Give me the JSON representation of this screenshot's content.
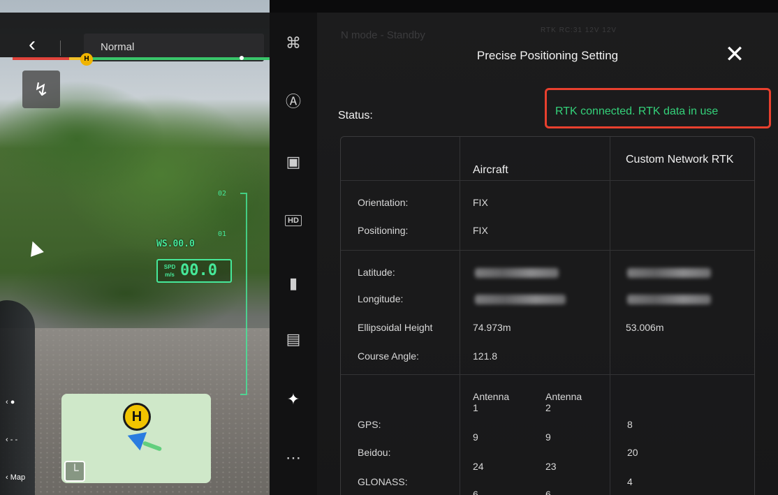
{
  "camera": {
    "mode": "Normal",
    "home_marker": "H",
    "ws_label": "WS.00.0",
    "speed_unit_top": "SPD",
    "speed_unit_bottom": "m/s",
    "speed_value": "00.0",
    "hud_mark_top": "02",
    "hud_mark_mid": "01",
    "map_label": "Map",
    "minimap_home": "H",
    "icons": [
      "back-icon",
      "route-icon",
      "aircraft-arrow-icon",
      "map-toggle-icon"
    ]
  },
  "iconcol": {
    "icons": [
      "aircraft-icon",
      "obstacle-icon",
      "remote-controller-icon",
      "hd-icon",
      "battery-icon",
      "camera-icon",
      "rtk-satellite-icon",
      "more-icon"
    ],
    "hd_label": "HD",
    "more_label": "⋯"
  },
  "panel": {
    "ghost_mode": "N mode - Standby",
    "ghost_status": "RTK  RC:31   12V  12V",
    "title": "Precise Positioning Setting",
    "close": "✕",
    "status_label": "Status:",
    "status_text": "RTK connected. RTK data in use",
    "colors": {
      "status_green": "#34d27a",
      "highlight_red": "#e8402e"
    },
    "table": {
      "col_aircraft": "Aircraft",
      "col_network": "Custom Network RTK",
      "orientation_label": "Orientation:",
      "orientation_aircraft": "FIX",
      "positioning_label": "Positioning:",
      "positioning_aircraft": "FIX",
      "latitude_label": "Latitude:",
      "longitude_label": "Longitude:",
      "ellipsoidal_label": "Ellipsoidal Height",
      "ellipsoidal_aircraft": "74.973m",
      "ellipsoidal_network": "53.006m",
      "course_label": "Course Angle:",
      "course_aircraft": "121.8",
      "antenna1": "Antenna 1",
      "antenna2": "Antenna 2",
      "gps_label": "GPS:",
      "beidou_label": "Beidou:",
      "glonass_label": "GLONASS:",
      "ant1_values": [
        "9",
        "24",
        "6"
      ],
      "ant2_values": [
        "9",
        "23",
        "6"
      ],
      "network_values": [
        "8",
        "20",
        "4"
      ]
    }
  }
}
